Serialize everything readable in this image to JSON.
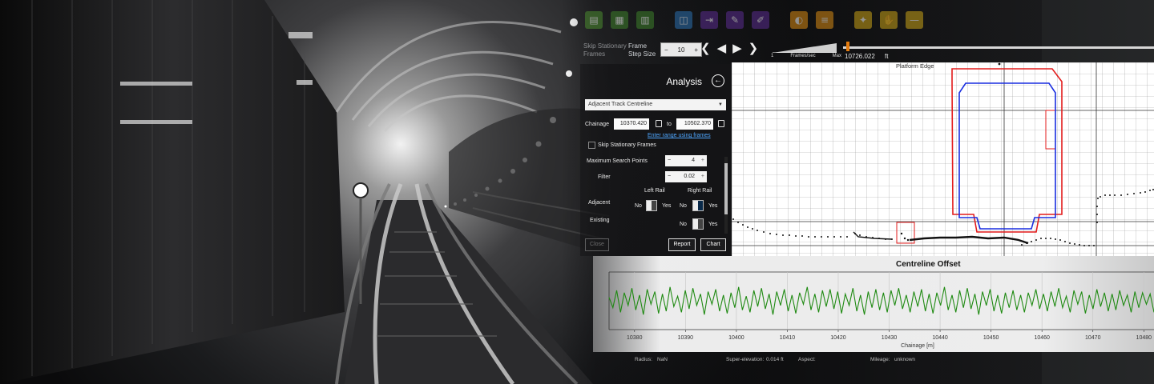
{
  "toolbar": {
    "icons": [
      {
        "name": "save-icon",
        "color": "#4b8b2f"
      },
      {
        "name": "document-icon",
        "color": "#3d7f2a"
      },
      {
        "name": "document-alt-icon",
        "color": "#3d7f2a"
      },
      {
        "name": "book-icon",
        "color": "#2a6fb0"
      },
      {
        "name": "export-icon",
        "color": "#5b2d91"
      },
      {
        "name": "edit-icon",
        "color": "#5b2d91"
      },
      {
        "name": "note-icon",
        "color": "#5b2d91"
      },
      {
        "name": "palette-icon",
        "color": "#d98b14"
      },
      {
        "name": "menu-icon",
        "color": "#d98b14"
      },
      {
        "name": "cursor-icon",
        "color": "#c9a217"
      },
      {
        "name": "hand-icon",
        "color": "#c9a217"
      },
      {
        "name": "minus-icon",
        "color": "#c9a217"
      }
    ]
  },
  "controls": {
    "skip_stationary": "Skip Stationary Frames",
    "frame_step_label": "Frame Step Size",
    "frame_step_value": "10",
    "speed_min": "1",
    "speed_label": "Frames/sec",
    "speed_max": "Max",
    "position_value": "10726.022",
    "position_unit": "ft",
    "position_fraction": 0.01
  },
  "panel": {
    "title": "Analysis",
    "analysis_type": "Adjacent Track Centreline",
    "chainage_label": "Chainage",
    "chainage_from": "10370.420",
    "to_label": "to",
    "chainage_to": "10502.370",
    "range_link": "Enter range using frames",
    "skip_frames_label": "Skip Stationary Frames",
    "max_search_label": "Maximum Search Points",
    "max_search_value": "4",
    "filter_label": "Filter",
    "filter_value": "0.02",
    "left_rail": "Left Rail",
    "right_rail": "Right Rail",
    "adjacent_label": "Adjacent",
    "existing_label": "Existing",
    "no": "No",
    "yes": "Yes",
    "close": "Close",
    "report": "Report",
    "chart": "Chart"
  },
  "profile": {
    "title": "Platform Edge"
  },
  "chart_data": {
    "type": "line",
    "title": "Centreline Offset",
    "xlabel": "Chainage [m]",
    "ylabel": "",
    "x_ticks": [
      10380,
      10390,
      10400,
      10410,
      10420,
      10430,
      10440,
      10450,
      10460,
      10470,
      10480
    ],
    "xlim": [
      10375,
      10482
    ],
    "ylim": [
      -0.05,
      0.05
    ],
    "series": [
      {
        "color": "#1f8a12",
        "x_start": 10375,
        "x_end": 10482,
        "values": [
          0.006,
          -0.012,
          0.018,
          -0.02,
          0.014,
          -0.008,
          0.022,
          -0.016,
          0.01,
          -0.024,
          0.02,
          -0.006,
          0.016,
          -0.022,
          0.012,
          -0.018,
          0.024,
          -0.01,
          0.008,
          -0.02,
          0.018,
          -0.014,
          0.022,
          -0.008,
          0.012,
          -0.024,
          0.016,
          -0.006,
          0.02,
          -0.018,
          0.01,
          -0.022,
          0.014,
          -0.012,
          0.024,
          -0.016,
          0.008,
          -0.02,
          0.018,
          -0.01,
          0.022,
          -0.014,
          0.012,
          -0.024,
          0.016,
          -0.008,
          0.02,
          -0.018,
          0.01,
          -0.022,
          0.014,
          -0.006,
          0.024,
          -0.016,
          0.012,
          -0.02,
          0.018,
          -0.01,
          0.02,
          -0.014,
          0.016,
          -0.022,
          0.012,
          -0.008,
          0.022,
          -0.018,
          0.01,
          -0.024,
          0.016,
          -0.012,
          0.02,
          -0.016,
          0.014,
          -0.02,
          0.018,
          -0.008,
          0.022,
          -0.014,
          0.01,
          -0.02,
          0.016,
          -0.01,
          0.02,
          -0.018,
          0.012,
          -0.022,
          0.014,
          -0.008,
          0.024,
          -0.016,
          0.01,
          -0.02,
          0.018,
          -0.012,
          0.022,
          -0.014,
          0.012,
          -0.024,
          0.016,
          -0.008,
          0.02,
          -0.018,
          0.01,
          -0.022,
          0.014,
          -0.012,
          0.018,
          -0.016,
          0.01,
          -0.02,
          0.014,
          -0.008,
          0.02,
          -0.014,
          0.012,
          -0.018,
          0.016,
          -0.01,
          0.022,
          -0.012,
          0.008,
          -0.02,
          0.018,
          -0.006,
          0.016,
          -0.022,
          0.01,
          -0.014,
          0.02,
          -0.01,
          0.014,
          -0.018,
          0.012,
          -0.016,
          0.018,
          -0.008,
          0.01,
          -0.02,
          0.016,
          -0.012,
          0.014,
          -0.006,
          0.012,
          -0.02
        ]
      }
    ]
  },
  "status": {
    "radius_label": "Radius:",
    "radius_value": "NaN",
    "superelevation_label": "Super-elevation:",
    "superelevation_value": "0.014 ft",
    "aspect_label": "Aspect:",
    "mileage_label": "Mileage:",
    "mileage_value": "unknown"
  }
}
